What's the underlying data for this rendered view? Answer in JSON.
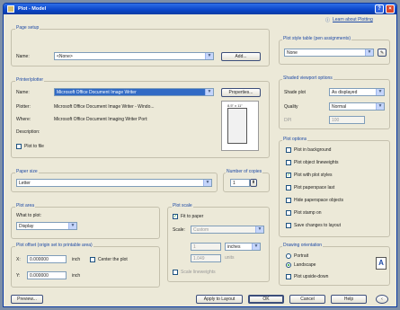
{
  "title": "Plot - Model",
  "learn_link": "Learn about Plotting",
  "page_setup": {
    "group": "Page setup",
    "name_label": "Name:",
    "name_value": "<None>",
    "add_btn": "Add..."
  },
  "plotter": {
    "group": "Printer/plotter",
    "name_label": "Name:",
    "name_value": "Microsoft Office Document Image Writer",
    "properties_btn": "Properties...",
    "plotter_label": "Plotter:",
    "plotter_value": "Microsoft Office Document Image Writer - Windo...",
    "where_label": "Where:",
    "where_value": "Microsoft Office Document Imaging Writer Port:",
    "desc_label": "Description:",
    "plot_to_file": "Plot to file",
    "preview_dim": "8.5\" x 11\""
  },
  "paper_size": {
    "group": "Paper size",
    "value": "Letter"
  },
  "copies": {
    "group": "Number of copies",
    "value": "1"
  },
  "plot_area": {
    "group": "Plot area",
    "what_label": "What to plot:",
    "what_value": "Display"
  },
  "plot_scale": {
    "group": "Plot scale",
    "fit": "Fit to paper",
    "scale_label": "Scale:",
    "scale_value": "Custom",
    "value1": "1",
    "unit": "inches",
    "value2": "1.049",
    "units_label": "units",
    "scale_lw": "Scale lineweights"
  },
  "plot_offset": {
    "group": "Plot offset (origin set to printable area)",
    "x_label": "X:",
    "x_value": "0.000000",
    "y_label": "Y:",
    "y_value": "0.000000",
    "unit": "inch",
    "center": "Center the plot"
  },
  "style_table": {
    "group": "Plot style table (pen assignments)",
    "value": "None"
  },
  "viewport": {
    "group": "Shaded viewport options",
    "shade_label": "Shade plot",
    "shade_value": "As displayed",
    "quality_label": "Quality",
    "quality_value": "Normal",
    "dpi_label": "DPI",
    "dpi_value": "100"
  },
  "options": {
    "group": "Plot options",
    "items": [
      "Plot in background",
      "Plot object lineweights",
      "Plot with plot styles",
      "Plot paperspace last",
      "Hide paperspace objects",
      "Plot stamp on",
      "Save changes to layout"
    ],
    "checked": [
      false,
      false,
      true,
      false,
      false,
      false,
      false
    ]
  },
  "orientation": {
    "group": "Drawing orientation",
    "portrait": "Portrait",
    "landscape": "Landscape",
    "upside": "Plot upside-down",
    "letter": "A"
  },
  "footer": {
    "preview": "Preview...",
    "apply": "Apply to Layout",
    "ok": "OK",
    "cancel": "Cancel",
    "help": "Help"
  }
}
